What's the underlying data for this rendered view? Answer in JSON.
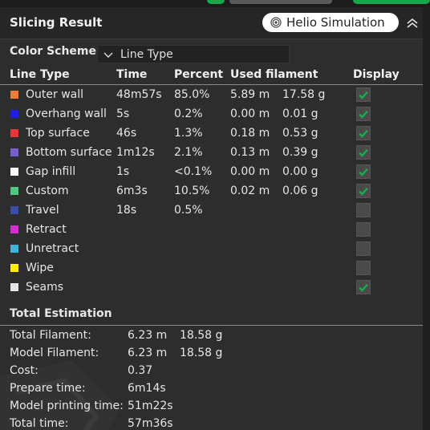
{
  "header": {
    "title": "Slicing Result",
    "helio_label": "Helio Simulation"
  },
  "color_scheme": {
    "label": "Color Scheme",
    "value": "Line Type"
  },
  "table": {
    "columns": [
      "Line Type",
      "Time",
      "Percent",
      "Used filament",
      "Display"
    ],
    "rows": [
      {
        "name": "Outer wall",
        "color": "#f07d3a",
        "time": "48m57s",
        "percent": "85.0%",
        "length": "5.89 m",
        "weight": "17.58 g",
        "display": true
      },
      {
        "name": "Overhang wall",
        "color": "#1e1ee6",
        "time": "5s",
        "percent": "0.2%",
        "length": "0.00 m",
        "weight": "0.01 g",
        "display": true
      },
      {
        "name": "Top surface",
        "color": "#e8363a",
        "time": "46s",
        "percent": "1.3%",
        "length": "0.18 m",
        "weight": "0.53 g",
        "display": true
      },
      {
        "name": "Bottom surface",
        "color": "#7a5ed0",
        "time": "1m12s",
        "percent": "2.1%",
        "length": "0.13 m",
        "weight": "0.39 g",
        "display": true
      },
      {
        "name": "Gap infill",
        "color": "#ffffff",
        "time": "1s",
        "percent": "<0.1%",
        "length": "0.00 m",
        "weight": "0.00 g",
        "display": true
      },
      {
        "name": "Custom",
        "color": "#4ec77f",
        "time": "6m3s",
        "percent": "10.5%",
        "length": "0.02 m",
        "weight": "0.06 g",
        "display": true
      },
      {
        "name": "Travel",
        "color": "#3a4fa8",
        "time": "18s",
        "percent": "0.5%",
        "length": "",
        "weight": "",
        "display": false
      },
      {
        "name": "Retract",
        "color": "#d22ed2",
        "time": "",
        "percent": "",
        "length": "",
        "weight": "",
        "display": false
      },
      {
        "name": "Unretract",
        "color": "#3fb4d8",
        "time": "",
        "percent": "",
        "length": "",
        "weight": "",
        "display": false
      },
      {
        "name": "Wipe",
        "color": "#ffee00",
        "time": "",
        "percent": "",
        "length": "",
        "weight": "",
        "display": false
      },
      {
        "name": "Seams",
        "color": "#e6e6e6",
        "time": "",
        "percent": "",
        "length": "",
        "weight": "",
        "display": true
      }
    ]
  },
  "total": {
    "title": "Total Estimation",
    "items": [
      {
        "label": "Total Filament:",
        "value": "6.23 m",
        "extra": "18.58 g"
      },
      {
        "label": "Model Filament:",
        "value": "6.23 m",
        "extra": "18.58 g"
      },
      {
        "label": "Cost:",
        "value": "0.37",
        "extra": ""
      },
      {
        "label": "Prepare time:",
        "value": "6m14s",
        "extra": ""
      },
      {
        "label": "Model printing time:",
        "value": "51m22s",
        "extra": ""
      },
      {
        "label": "Total time:",
        "value": "57m36s",
        "extra": ""
      }
    ]
  },
  "colors": {
    "check_green": "#19b04a",
    "panel_bg": "#2d2d2d",
    "accent_green": "#18a84b"
  },
  "icons": {
    "helio": "spiral-icon",
    "collapse": "double-chevron-up-icon",
    "dropdown": "chevron-down-icon",
    "check": "checkmark-icon"
  }
}
